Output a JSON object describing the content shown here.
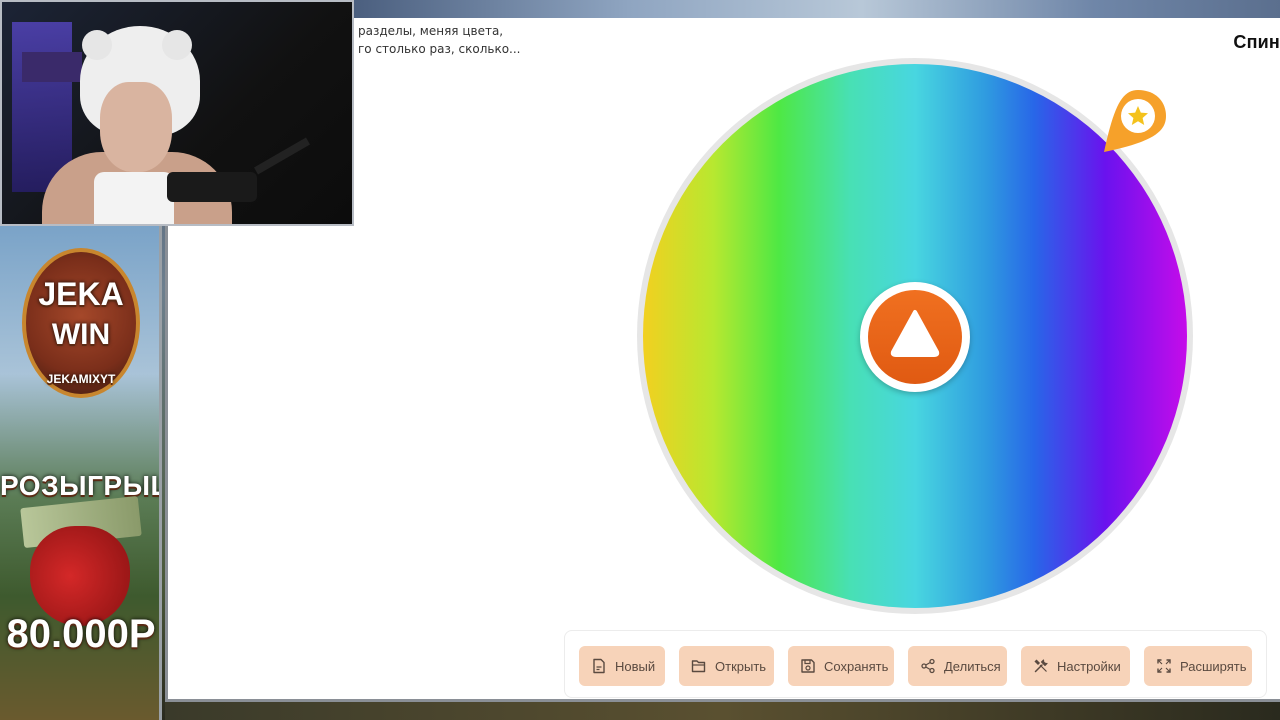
{
  "app": {
    "title": "Спин",
    "description_line1": "разделы, меняя цвета,",
    "description_line2": "го столько раз, сколько..."
  },
  "wheel": {
    "colors": [
      "#f2d020",
      "#b7e830",
      "#4ee844",
      "#48e0b4",
      "#48d6e0",
      "#2f9be0",
      "#2866e8",
      "#6a12ee",
      "#c50cea"
    ],
    "spin_icon": "play-triangle-icon",
    "pointer_icon": "star-pin-icon",
    "accent_color": "#ea6418"
  },
  "toolbar": {
    "new_label": "Новый",
    "open_label": "Открыть",
    "save_label": "Сохранять",
    "share_label": "Делиться",
    "settings_label": "Настройки",
    "expand_label": "Расширять"
  },
  "overlay": {
    "logo_line1": "JEKA",
    "logo_line2": "WIN",
    "channel": "JEKAMIXYT",
    "giveaway": "РОЗЫГРЫШ",
    "prize": "80.000Р"
  }
}
